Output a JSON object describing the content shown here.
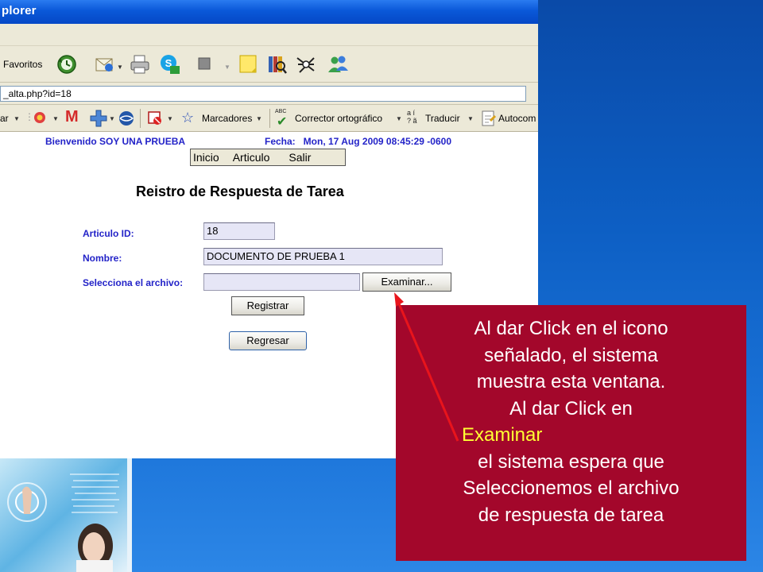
{
  "window": {
    "title": "plorer"
  },
  "toolbar": {
    "favorites_label": "Favoritos",
    "icons": [
      "history-icon",
      "mail-icon",
      "print-icon",
      "skype-icon",
      "stop-icon",
      "notes-icon",
      "research-icon",
      "messenger-icon",
      "users-icon"
    ]
  },
  "address_bar": {
    "value": "_alta.php?id=18"
  },
  "google_toolbar": {
    "left_cut_label": "ar",
    "bookmarks_label": "Marcadores",
    "spellcheck_label": "Corrector ortográfico",
    "translate_label": "Traducir",
    "autofill_label": "Autocom",
    "translate_icon_glyphs": "a í\n? ã",
    "abc_label": "ABC"
  },
  "page": {
    "welcome": "Bienvenido SOY UNA PRUEBA",
    "fecha": "Fecha:   Mon, 17 Aug 2009 08:45:29 -0600",
    "nav": {
      "inicio": "Inicio",
      "articulo": "Articulo",
      "salir": "Salir"
    },
    "title": "Reistro de Respuesta de Tarea",
    "form": {
      "articulo_label": "Articulo ID:",
      "articulo_value": "18",
      "nombre_label": "Nombre:",
      "nombre_value": "DOCUMENTO DE PRUEBA 1",
      "archivo_label": "Selecciona el archivo:",
      "archivo_value": "",
      "examinar_label": "Examinar...",
      "registrar_label": "Registrar",
      "regresar_label": "Regresar"
    }
  },
  "callout": {
    "line1": "Al dar Click en el icono",
    "line2": "señalado, el sistema",
    "line3": "muestra esta ventana.",
    "line4": "Al dar Click en",
    "highlight": "Examinar",
    "line5": "el sistema espera que",
    "line6": "Seleccionemos el archivo",
    "line7": "de respuesta de tarea"
  },
  "colors": {
    "slide_background": "#0d5fc4",
    "callout_background": "#a3072b",
    "callout_text": "#ffffff",
    "callout_highlight": "#ffff33",
    "form_label": "#2323c8",
    "arrow": "#e8141c",
    "titlebar": "#0a58d8"
  }
}
